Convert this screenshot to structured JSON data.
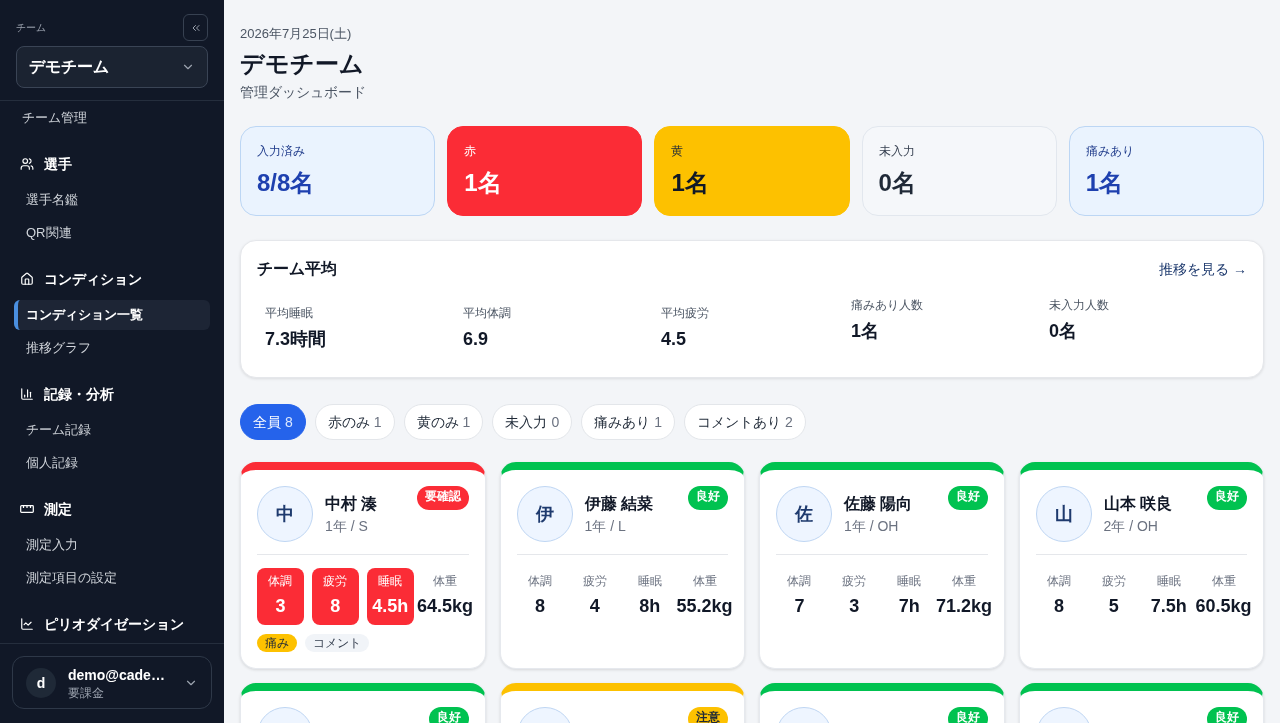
{
  "sidebar": {
    "team_label": "チーム",
    "team_select": {
      "value": "デモチーム"
    },
    "top_items": [
      {
        "label": "チーム管理",
        "selected": false
      }
    ],
    "sections": [
      {
        "label": "選手",
        "children": [
          {
            "label": "選手名鑑",
            "selected": false
          },
          {
            "label": "QR関連",
            "selected": false
          }
        ]
      },
      {
        "label": "コンディション",
        "children": [
          {
            "label": "コンディション一覧",
            "selected": true
          },
          {
            "label": "推移グラフ",
            "selected": false
          }
        ]
      },
      {
        "label": "記録・分析",
        "children": [
          {
            "label": "チーム記録",
            "selected": false
          },
          {
            "label": "個人記録",
            "selected": false
          }
        ]
      },
      {
        "label": "測定",
        "children": [
          {
            "label": "測定入力",
            "selected": false
          },
          {
            "label": "測定項目の設定",
            "selected": false
          }
        ]
      },
      {
        "label": "ピリオダイゼーション"
      }
    ],
    "account": {
      "initial": "d",
      "email": "demo@cade…",
      "plan": "要課金"
    }
  },
  "header": {
    "date": "2026年7月25日(土)",
    "title": "デモチーム",
    "subtitle": "管理ダッシュボード"
  },
  "stats": [
    {
      "label": "入力済み",
      "value": "8/8名",
      "kind": "info"
    },
    {
      "label": "赤",
      "value": "1名",
      "kind": "red"
    },
    {
      "label": "黄",
      "value": "1名",
      "kind": "yellow"
    },
    {
      "label": "未入力",
      "value": "0名",
      "kind": "neutral"
    },
    {
      "label": "痛みあり",
      "value": "1名",
      "kind": "info"
    }
  ],
  "team_average": {
    "title": "チーム平均",
    "link": "推移を見る →",
    "metrics": [
      {
        "label": "平均睡眠",
        "value": "7.3時間",
        "kind": "average"
      },
      {
        "label": "平均体調",
        "value": "6.9",
        "kind": "average"
      },
      {
        "label": "平均疲労",
        "value": "4.5",
        "kind": "average"
      },
      {
        "label": "痛みあり人数",
        "value": "1名",
        "kind": "count"
      },
      {
        "label": "未入力人数",
        "value": "0名",
        "kind": "count"
      }
    ]
  },
  "filters": [
    {
      "label": "全員",
      "count": "8",
      "selected": true
    },
    {
      "label": "赤のみ",
      "count": "1",
      "selected": false
    },
    {
      "label": "黄のみ",
      "count": "1",
      "selected": false
    },
    {
      "label": "未入力",
      "count": "0",
      "selected": false
    },
    {
      "label": "痛みあり",
      "count": "1",
      "selected": false
    },
    {
      "label": "コメントあり",
      "count": "2",
      "selected": false
    }
  ],
  "players": [
    {
      "initial": "中",
      "name": "中村 湊",
      "meta": "1年 / S",
      "kind": "alert",
      "badge": "要確認",
      "metrics": [
        {
          "label": "体調",
          "value": "3",
          "alert": true
        },
        {
          "label": "疲労",
          "value": "8",
          "alert": true
        },
        {
          "label": "睡眠",
          "value": "4.5h",
          "alert": true
        },
        {
          "label": "体重",
          "value": "64.5kg",
          "alert": false
        }
      ],
      "tags": [
        {
          "label": "痛み",
          "kind": "pain"
        },
        {
          "label": "コメント",
          "kind": "comment"
        }
      ]
    },
    {
      "initial": "伊",
      "name": "伊藤 結菜",
      "meta": "1年 / L",
      "kind": "good",
      "badge": "良好",
      "metrics": [
        {
          "label": "体調",
          "value": "8",
          "alert": false
        },
        {
          "label": "疲労",
          "value": "4",
          "alert": false
        },
        {
          "label": "睡眠",
          "value": "8h",
          "alert": false
        },
        {
          "label": "体重",
          "value": "55.2kg",
          "alert": false
        }
      ]
    },
    {
      "initial": "佐",
      "name": "佐藤 陽向",
      "meta": "1年 / OH",
      "kind": "good",
      "badge": "良好",
      "metrics": [
        {
          "label": "体調",
          "value": "7",
          "alert": false
        },
        {
          "label": "疲労",
          "value": "3",
          "alert": false
        },
        {
          "label": "睡眠",
          "value": "7h",
          "alert": false
        },
        {
          "label": "体重",
          "value": "71.2kg",
          "alert": false
        }
      ]
    },
    {
      "initial": "山",
      "name": "山本 咲良",
      "meta": "2年 / OH",
      "kind": "good",
      "badge": "良好",
      "metrics": [
        {
          "label": "体調",
          "value": "8",
          "alert": false
        },
        {
          "label": "疲労",
          "value": "5",
          "alert": false
        },
        {
          "label": "睡眠",
          "value": "7.5h",
          "alert": false
        },
        {
          "label": "体重",
          "value": "60.5kg",
          "alert": false
        }
      ]
    },
    {
      "kind": "good",
      "badge": "良好"
    },
    {
      "kind": "caution",
      "badge": "注意"
    },
    {
      "kind": "good",
      "badge": "良好"
    },
    {
      "kind": "good",
      "badge": "良好"
    }
  ]
}
